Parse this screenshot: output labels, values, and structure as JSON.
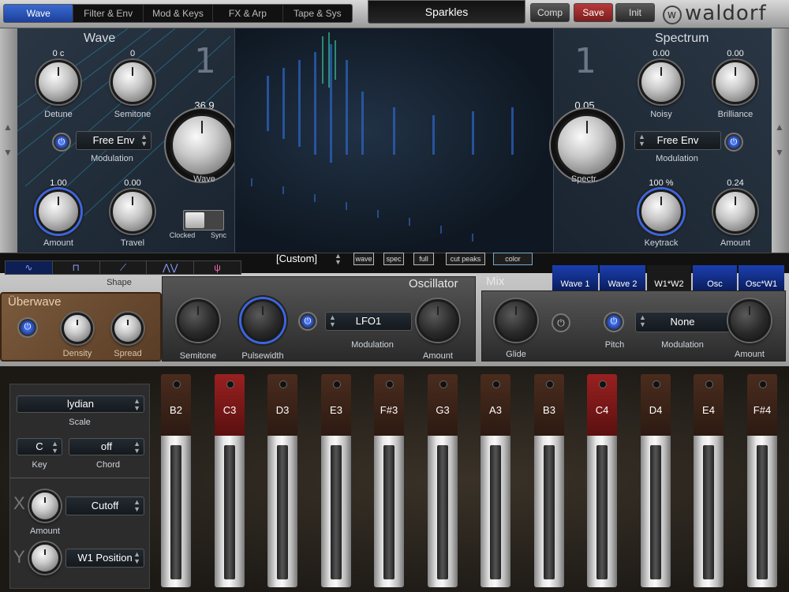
{
  "tabs": [
    "Wave",
    "Filter & Env",
    "Mod & Keys",
    "FX & Arp",
    "Tape & Sys"
  ],
  "preset_name": "Sparkles",
  "buttons": {
    "comp": "Comp",
    "save": "Save",
    "init": "Init"
  },
  "logo": "waldorf",
  "wave": {
    "title": "Wave",
    "number": "1",
    "detune": {
      "label": "Detune",
      "value": "0 c"
    },
    "semitone": {
      "label": "Semitone",
      "value": "0"
    },
    "wave_knob": {
      "label": "Wave",
      "value": "36.9"
    },
    "modulation": {
      "source": "Free Env",
      "label": "Modulation"
    },
    "amount": {
      "label": "Amount",
      "value": "1.00"
    },
    "travel": {
      "label": "Travel",
      "value": "0.00"
    },
    "switch": {
      "left": "Clocked",
      "right": "Sync"
    }
  },
  "spectrum": {
    "title": "Spectrum",
    "number": "1",
    "noisy": {
      "label": "Noisy",
      "value": "0.00"
    },
    "brilliance": {
      "label": "Brilliance",
      "value": "0.00"
    },
    "spectr_knob": {
      "label": "Spectr.",
      "value": "0.05"
    },
    "modulation": {
      "source": "Free Env",
      "label": "Modulation"
    },
    "keytrack": {
      "label": "Keytrack",
      "value": "100 %"
    },
    "amount": {
      "label": "Amount",
      "value": "0.24"
    }
  },
  "visual": {
    "preset": "[Custom]",
    "buttons": [
      "wave",
      "spec",
      "full",
      "cut peaks",
      "color"
    ]
  },
  "shape": {
    "label": "Shape",
    "items": [
      "∿",
      "⊓",
      "⟋",
      "⋀⋁",
      "ψ"
    ]
  },
  "oscillator": {
    "title": "Oscillator",
    "semitone": "Semitone",
    "pulsewidth": "Pulsewidth",
    "modulation": {
      "source": "LFO1",
      "label": "Modulation"
    },
    "amount": "Amount"
  },
  "uberwave": {
    "title": "Überwave",
    "density": "Density",
    "spread": "Spread"
  },
  "mix": {
    "title": "Mix",
    "tabs": [
      "Wave 1",
      "Wave 2",
      "W1*W2",
      "Osc",
      "Osc*W1"
    ],
    "glide": "Glide",
    "pitch": "Pitch",
    "modulation": {
      "source": "None",
      "label": "Modulation"
    },
    "amount": "Amount"
  },
  "xy": {
    "scale": {
      "value": "lydian",
      "label": "Scale"
    },
    "key": {
      "value": "C",
      "label": "Key"
    },
    "chord": {
      "value": "off",
      "label": "Chord"
    },
    "x": {
      "axis": "X",
      "target": "Cutoff",
      "label": "Amount"
    },
    "y": {
      "axis": "Y",
      "target": "W1 Position"
    }
  },
  "faders": [
    {
      "note": "B2",
      "red": false
    },
    {
      "note": "C3",
      "red": true
    },
    {
      "note": "D3",
      "red": false
    },
    {
      "note": "E3",
      "red": false
    },
    {
      "note": "F#3",
      "red": false
    },
    {
      "note": "G3",
      "red": false
    },
    {
      "note": "A3",
      "red": false
    },
    {
      "note": "B3",
      "red": false
    },
    {
      "note": "C4",
      "red": true
    },
    {
      "note": "D4",
      "red": false
    },
    {
      "note": "E4",
      "red": false
    },
    {
      "note": "F#4",
      "red": false
    }
  ],
  "colors": {
    "accent": "#3b66e0",
    "save": "#b83a3a",
    "brown": "#6a4a30"
  }
}
